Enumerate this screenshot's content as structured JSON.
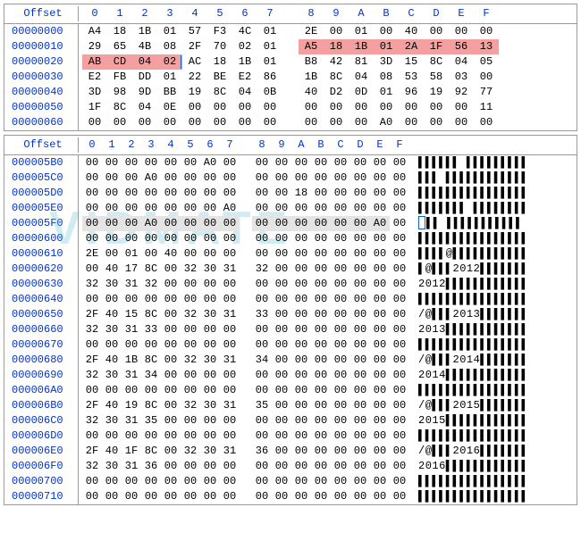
{
  "panel1": {
    "offsetLabel": "Offset",
    "cols": [
      "0",
      "1",
      "2",
      "3",
      "4",
      "5",
      "6",
      "7",
      "8",
      "9",
      "A",
      "B",
      "C",
      "D",
      "E",
      "F"
    ],
    "rows": [
      {
        "off": "00000000",
        "b": [
          "A4",
          "18",
          "1B",
          "01",
          "57",
          "F3",
          "4C",
          "01",
          "2E",
          "00",
          "01",
          "00",
          "40",
          "00",
          "00",
          "00"
        ]
      },
      {
        "off": "00000010",
        "b": [
          "29",
          "65",
          "4B",
          "08",
          "2F",
          "70",
          "02",
          "01",
          "A5",
          "18",
          "1B",
          "01",
          "2A",
          "1F",
          "56",
          "13"
        ],
        "hl": [
          8,
          9,
          10,
          11,
          12,
          13,
          14,
          15
        ]
      },
      {
        "off": "00000020",
        "b": [
          "AB",
          "CD",
          "04",
          "02",
          "AC",
          "18",
          "1B",
          "01",
          "B8",
          "42",
          "81",
          "3D",
          "15",
          "8C",
          "04",
          "05"
        ],
        "hl": [
          0,
          1,
          2
        ],
        "sel": 3
      },
      {
        "off": "00000030",
        "b": [
          "E2",
          "FB",
          "DD",
          "01",
          "22",
          "BE",
          "E2",
          "86",
          "1B",
          "8C",
          "04",
          "08",
          "53",
          "58",
          "03",
          "00"
        ]
      },
      {
        "off": "00000040",
        "b": [
          "3D",
          "98",
          "9D",
          "BB",
          "19",
          "8C",
          "04",
          "0B",
          "40",
          "D2",
          "0D",
          "01",
          "96",
          "19",
          "92",
          "77"
        ]
      },
      {
        "off": "00000050",
        "b": [
          "1F",
          "8C",
          "04",
          "0E",
          "00",
          "00",
          "00",
          "00",
          "00",
          "00",
          "00",
          "00",
          "00",
          "00",
          "00",
          "11"
        ]
      },
      {
        "off": "00000060",
        "b": [
          "00",
          "00",
          "00",
          "00",
          "00",
          "00",
          "00",
          "00",
          "00",
          "00",
          "00",
          "A0",
          "00",
          "00",
          "00",
          "00"
        ]
      }
    ]
  },
  "panel2": {
    "offsetLabel": "Offset",
    "cols": [
      "0",
      "1",
      "2",
      "3",
      "4",
      "5",
      "6",
      "7",
      "8",
      "9",
      "A",
      "B",
      "C",
      "D",
      "E",
      "F"
    ],
    "watermark": "VIDMATE",
    "rows": [
      {
        "off": "000005B0",
        "b": [
          "00",
          "00",
          "00",
          "00",
          "00",
          "00",
          "A0",
          "00",
          "00",
          "00",
          "00",
          "00",
          "00",
          "00",
          "00",
          "00"
        ],
        "ascii": "▌▌▌▌▌▌ ▌▌▌▌▌▌▌▌▌"
      },
      {
        "off": "000005C0",
        "b": [
          "00",
          "00",
          "00",
          "A0",
          "00",
          "00",
          "00",
          "00",
          "00",
          "00",
          "00",
          "00",
          "00",
          "00",
          "00",
          "00"
        ],
        "ascii": "▌▌▌ ▌▌▌▌▌▌▌▌▌▌▌▌"
      },
      {
        "off": "000005D0",
        "b": [
          "00",
          "00",
          "00",
          "00",
          "00",
          "00",
          "00",
          "00",
          "00",
          "00",
          "18",
          "00",
          "00",
          "00",
          "00",
          "00"
        ],
        "ascii": "▌▌▌▌▌▌▌▌▌▌▌▌▌▌▌▌"
      },
      {
        "off": "000005E0",
        "b": [
          "00",
          "00",
          "00",
          "00",
          "00",
          "00",
          "00",
          "A0",
          "00",
          "00",
          "00",
          "00",
          "00",
          "00",
          "00",
          "00"
        ],
        "ascii": "▌▌▌▌▌▌▌ ▌▌▌▌▌▌▌▌"
      },
      {
        "off": "000005F0",
        "b": [
          "00",
          "00",
          "00",
          "A0",
          "00",
          "00",
          "00",
          "00",
          "00",
          "00",
          "00",
          "00",
          "00",
          "00",
          "A0",
          "00"
        ],
        "gray": [
          0,
          1,
          2,
          3,
          4,
          5,
          6,
          7,
          8,
          9,
          10,
          11,
          12,
          13,
          14
        ],
        "ascii": "▌▌ ▌▌▌▌▌▌▌▌▌▌▌ ",
        "cursor": true
      },
      {
        "off": "00000600",
        "b": [
          "00",
          "00",
          "00",
          "00",
          "00",
          "00",
          "00",
          "00",
          "00",
          "00",
          "00",
          "00",
          "00",
          "00",
          "00",
          "00"
        ],
        "ascii": "▌▌▌▌▌▌▌▌▌▌▌▌▌▌▌▌"
      },
      {
        "off": "00000610",
        "b": [
          "2E",
          "00",
          "01",
          "00",
          "40",
          "00",
          "00",
          "00",
          "00",
          "00",
          "00",
          "00",
          "00",
          "00",
          "00",
          "00"
        ],
        "ascii": "▌▌▌▌@▌▌▌▌▌▌▌▌▌▌▌"
      },
      {
        "off": "00000620",
        "b": [
          "00",
          "40",
          "17",
          "8C",
          "00",
          "32",
          "30",
          "31",
          "32",
          "00",
          "00",
          "00",
          "00",
          "00",
          "00",
          "00"
        ],
        "ascii": "▌@▌▌▌2012▌▌▌▌▌▌▌"
      },
      {
        "off": "00000630",
        "b": [
          "32",
          "30",
          "31",
          "32",
          "00",
          "00",
          "00",
          "00",
          "00",
          "00",
          "00",
          "00",
          "00",
          "00",
          "00",
          "00"
        ],
        "ascii": "2012▌▌▌▌▌▌▌▌▌▌▌▌"
      },
      {
        "off": "00000640",
        "b": [
          "00",
          "00",
          "00",
          "00",
          "00",
          "00",
          "00",
          "00",
          "00",
          "00",
          "00",
          "00",
          "00",
          "00",
          "00",
          "00"
        ],
        "ascii": "▌▌▌▌▌▌▌▌▌▌▌▌▌▌▌▌"
      },
      {
        "off": "00000650",
        "b": [
          "2F",
          "40",
          "15",
          "8C",
          "00",
          "32",
          "30",
          "31",
          "33",
          "00",
          "00",
          "00",
          "00",
          "00",
          "00",
          "00"
        ],
        "ascii": "/@▌▌▌2013▌▌▌▌▌▌▌"
      },
      {
        "off": "00000660",
        "b": [
          "32",
          "30",
          "31",
          "33",
          "00",
          "00",
          "00",
          "00",
          "00",
          "00",
          "00",
          "00",
          "00",
          "00",
          "00",
          "00"
        ],
        "ascii": "2013▌▌▌▌▌▌▌▌▌▌▌▌"
      },
      {
        "off": "00000670",
        "b": [
          "00",
          "00",
          "00",
          "00",
          "00",
          "00",
          "00",
          "00",
          "00",
          "00",
          "00",
          "00",
          "00",
          "00",
          "00",
          "00"
        ],
        "ascii": "▌▌▌▌▌▌▌▌▌▌▌▌▌▌▌▌"
      },
      {
        "off": "00000680",
        "b": [
          "2F",
          "40",
          "1B",
          "8C",
          "00",
          "32",
          "30",
          "31",
          "34",
          "00",
          "00",
          "00",
          "00",
          "00",
          "00",
          "00"
        ],
        "ascii": "/@▌▌▌2014▌▌▌▌▌▌▌"
      },
      {
        "off": "00000690",
        "b": [
          "32",
          "30",
          "31",
          "34",
          "00",
          "00",
          "00",
          "00",
          "00",
          "00",
          "00",
          "00",
          "00",
          "00",
          "00",
          "00"
        ],
        "ascii": "2014▌▌▌▌▌▌▌▌▌▌▌▌"
      },
      {
        "off": "000006A0",
        "b": [
          "00",
          "00",
          "00",
          "00",
          "00",
          "00",
          "00",
          "00",
          "00",
          "00",
          "00",
          "00",
          "00",
          "00",
          "00",
          "00"
        ],
        "ascii": "▌▌▌▌▌▌▌▌▌▌▌▌▌▌▌▌"
      },
      {
        "off": "000006B0",
        "b": [
          "2F",
          "40",
          "19",
          "8C",
          "00",
          "32",
          "30",
          "31",
          "35",
          "00",
          "00",
          "00",
          "00",
          "00",
          "00",
          "00"
        ],
        "ascii": "/@▌▌▌2015▌▌▌▌▌▌▌"
      },
      {
        "off": "000006C0",
        "b": [
          "32",
          "30",
          "31",
          "35",
          "00",
          "00",
          "00",
          "00",
          "00",
          "00",
          "00",
          "00",
          "00",
          "00",
          "00",
          "00"
        ],
        "ascii": "2015▌▌▌▌▌▌▌▌▌▌▌▌"
      },
      {
        "off": "000006D0",
        "b": [
          "00",
          "00",
          "00",
          "00",
          "00",
          "00",
          "00",
          "00",
          "00",
          "00",
          "00",
          "00",
          "00",
          "00",
          "00",
          "00"
        ],
        "ascii": "▌▌▌▌▌▌▌▌▌▌▌▌▌▌▌▌"
      },
      {
        "off": "000006E0",
        "b": [
          "2F",
          "40",
          "1F",
          "8C",
          "00",
          "32",
          "30",
          "31",
          "36",
          "00",
          "00",
          "00",
          "00",
          "00",
          "00",
          "00"
        ],
        "ascii": "/@▌▌▌2016▌▌▌▌▌▌▌"
      },
      {
        "off": "000006F0",
        "b": [
          "32",
          "30",
          "31",
          "36",
          "00",
          "00",
          "00",
          "00",
          "00",
          "00",
          "00",
          "00",
          "00",
          "00",
          "00",
          "00"
        ],
        "ascii": "2016▌▌▌▌▌▌▌▌▌▌▌▌"
      },
      {
        "off": "00000700",
        "b": [
          "00",
          "00",
          "00",
          "00",
          "00",
          "00",
          "00",
          "00",
          "00",
          "00",
          "00",
          "00",
          "00",
          "00",
          "00",
          "00"
        ],
        "ascii": "▌▌▌▌▌▌▌▌▌▌▌▌▌▌▌▌"
      },
      {
        "off": "00000710",
        "b": [
          "00",
          "00",
          "00",
          "00",
          "00",
          "00",
          "00",
          "00",
          "00",
          "00",
          "00",
          "00",
          "00",
          "00",
          "00",
          "00"
        ],
        "ascii": "▌▌▌▌▌▌▌▌▌▌▌▌▌▌▌▌"
      }
    ]
  }
}
